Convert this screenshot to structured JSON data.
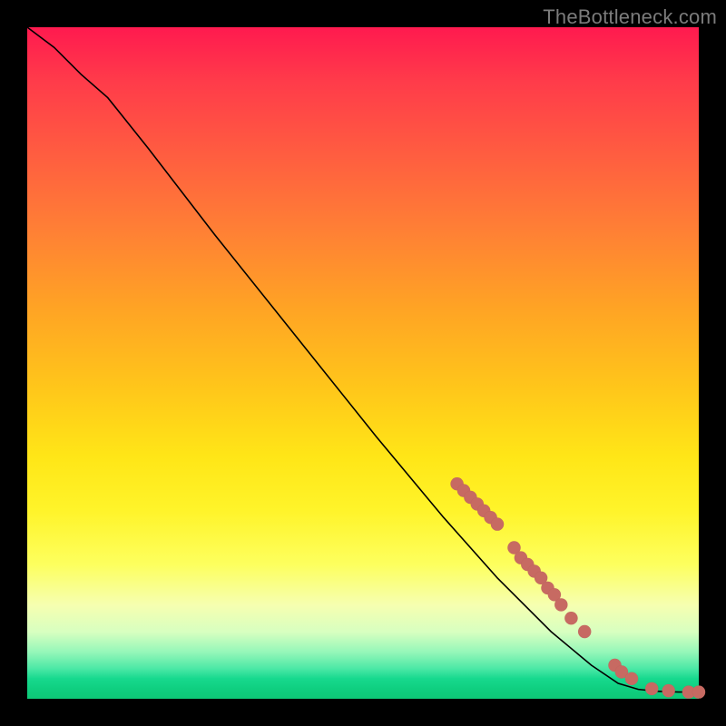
{
  "watermark": "TheBottleneck.com",
  "colors": {
    "background": "#000000",
    "curve": "#000000",
    "dot": "#c76a62"
  },
  "chart_data": {
    "type": "line",
    "title": "",
    "xlabel": "",
    "ylabel": "",
    "xlim": [
      0,
      100
    ],
    "ylim": [
      0,
      100
    ],
    "grid": false,
    "legend": false,
    "curve_points": [
      {
        "x": 0,
        "y": 100
      },
      {
        "x": 4,
        "y": 97
      },
      {
        "x": 8,
        "y": 93
      },
      {
        "x": 12,
        "y": 89.5
      },
      {
        "x": 18,
        "y": 82
      },
      {
        "x": 28,
        "y": 69
      },
      {
        "x": 40,
        "y": 54
      },
      {
        "x": 52,
        "y": 39
      },
      {
        "x": 62,
        "y": 27
      },
      {
        "x": 70,
        "y": 18
      },
      {
        "x": 78,
        "y": 10
      },
      {
        "x": 84,
        "y": 5
      },
      {
        "x": 88,
        "y": 2.3
      },
      {
        "x": 91,
        "y": 1.4
      },
      {
        "x": 94,
        "y": 1.1
      },
      {
        "x": 97,
        "y": 1.0
      },
      {
        "x": 100,
        "y": 1.0
      }
    ],
    "series": [
      {
        "name": "markers",
        "type": "scatter",
        "points": [
          {
            "x": 64.0,
            "y": 32.0
          },
          {
            "x": 65.0,
            "y": 31.0
          },
          {
            "x": 66.0,
            "y": 30.0
          },
          {
            "x": 67.0,
            "y": 29.0
          },
          {
            "x": 68.0,
            "y": 28.0
          },
          {
            "x": 69.0,
            "y": 27.0
          },
          {
            "x": 70.0,
            "y": 26.0
          },
          {
            "x": 72.5,
            "y": 22.5
          },
          {
            "x": 73.5,
            "y": 21.0
          },
          {
            "x": 74.5,
            "y": 20.0
          },
          {
            "x": 75.5,
            "y": 19.0
          },
          {
            "x": 76.5,
            "y": 18.0
          },
          {
            "x": 77.5,
            "y": 16.5
          },
          {
            "x": 78.5,
            "y": 15.5
          },
          {
            "x": 79.5,
            "y": 14.0
          },
          {
            "x": 81.0,
            "y": 12.0
          },
          {
            "x": 83.0,
            "y": 10.0
          },
          {
            "x": 87.5,
            "y": 5.0
          },
          {
            "x": 88.5,
            "y": 4.0
          },
          {
            "x": 90.0,
            "y": 3.0
          },
          {
            "x": 93.0,
            "y": 1.5
          },
          {
            "x": 95.5,
            "y": 1.2
          },
          {
            "x": 98.5,
            "y": 1.0
          },
          {
            "x": 100.0,
            "y": 1.0
          }
        ]
      }
    ]
  }
}
